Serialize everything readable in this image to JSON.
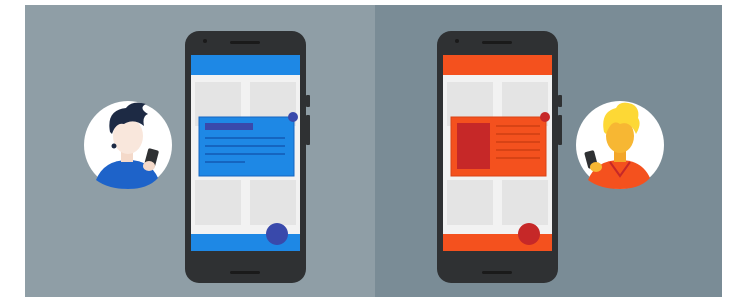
{
  "scene": {
    "left_panel": {
      "background": "#8f9ea6",
      "accent": "#1e88e5",
      "accent_dark": "#3949ab",
      "avatar": "person-with-black-hair"
    },
    "right_panel": {
      "background": "#7a8c96",
      "accent": "#f4511e",
      "accent_dark": "#c62828",
      "avatar": "person-with-blonde-hair"
    },
    "phone_body": "#2f3133",
    "phone_screen": "#f2f2f2",
    "placeholder_tile": "#e6e6e6"
  }
}
